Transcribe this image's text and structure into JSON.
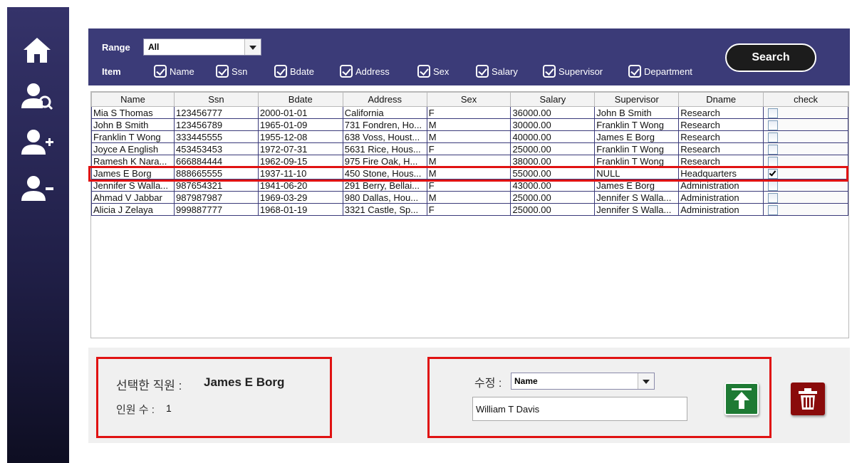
{
  "sidebar": {
    "items": [
      {
        "icon": "home-icon"
      },
      {
        "icon": "user-search-icon"
      },
      {
        "icon": "user-add-icon"
      },
      {
        "icon": "user-remove-icon"
      }
    ]
  },
  "filter": {
    "range_label": "Range",
    "range_value": "All",
    "item_label": "Item",
    "items": [
      "Name",
      "Ssn",
      "Bdate",
      "Address",
      "Sex",
      "Salary",
      "Supervisor",
      "Department"
    ],
    "search_label": "Search"
  },
  "table": {
    "columns": [
      "Name",
      "Ssn",
      "Bdate",
      "Address",
      "Sex",
      "Salary",
      "Supervisor",
      "Dname",
      "check"
    ],
    "rows": [
      {
        "name": "Mia S Thomas",
        "ssn": "123456777",
        "bdate": "2000-01-01",
        "address": "California",
        "sex": "F",
        "salary": "36000.00",
        "supervisor": "John B Smith",
        "dname": "Research",
        "checked": false
      },
      {
        "name": "John B Smith",
        "ssn": "123456789",
        "bdate": "1965-01-09",
        "address": "731 Fondren, Ho...",
        "sex": "M",
        "salary": "30000.00",
        "supervisor": "Franklin T Wong",
        "dname": "Research",
        "checked": false
      },
      {
        "name": "Franklin T Wong",
        "ssn": "333445555",
        "bdate": "1955-12-08",
        "address": "638 Voss, Houst...",
        "sex": "M",
        "salary": "40000.00",
        "supervisor": "James E Borg",
        "dname": "Research",
        "checked": false
      },
      {
        "name": "Joyce A English",
        "ssn": "453453453",
        "bdate": "1972-07-31",
        "address": "5631 Rice, Hous...",
        "sex": "F",
        "salary": "25000.00",
        "supervisor": "Franklin T Wong",
        "dname": "Research",
        "checked": false
      },
      {
        "name": "Ramesh K Nara...",
        "ssn": "666884444",
        "bdate": "1962-09-15",
        "address": "975 Fire Oak, H...",
        "sex": "M",
        "salary": "38000.00",
        "supervisor": "Franklin T Wong",
        "dname": "Research",
        "checked": false
      },
      {
        "name": "James E Borg",
        "ssn": "888665555",
        "bdate": "1937-11-10",
        "address": "450 Stone, Hous...",
        "sex": "M",
        "salary": "55000.00",
        "supervisor": "NULL",
        "dname": "Headquarters",
        "checked": true
      },
      {
        "name": "Jennifer S Walla...",
        "ssn": "987654321",
        "bdate": "1941-06-20",
        "address": "291 Berry, Bellai...",
        "sex": "F",
        "salary": "43000.00",
        "supervisor": "James E Borg",
        "dname": "Administration",
        "checked": false
      },
      {
        "name": "Ahmad V Jabbar",
        "ssn": "987987987",
        "bdate": "1969-03-29",
        "address": "980 Dallas, Hou...",
        "sex": "M",
        "salary": "25000.00",
        "supervisor": "Jennifer S Walla...",
        "dname": "Administration",
        "checked": false
      },
      {
        "name": "Alicia J Zelaya",
        "ssn": "999887777",
        "bdate": "1968-01-19",
        "address": "3321 Castle, Sp...",
        "sex": "F",
        "salary": "25000.00",
        "supervisor": "Jennifer S Walla...",
        "dname": "Administration",
        "checked": false
      }
    ]
  },
  "selection": {
    "selected_label": "선택한 직원 :",
    "selected_value": "James E Borg",
    "count_label": "인원 수 :",
    "count_value": "1"
  },
  "modify": {
    "label": "수정 :",
    "field_value": "Name",
    "input_value": "William T Davis"
  },
  "colors": {
    "sidebar": "#2a2958",
    "topbar": "#3b3b78",
    "highlight": "#e01212",
    "update_button": "#1e7a34",
    "delete_button": "#8a0b0b"
  }
}
